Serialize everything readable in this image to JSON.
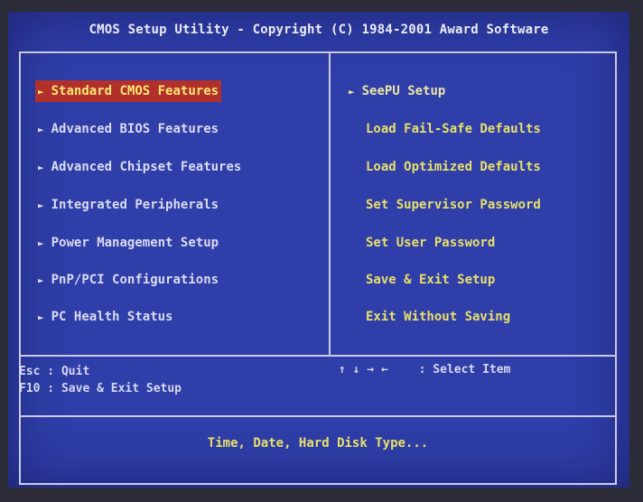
{
  "header": {
    "title": "CMOS Setup Utility - Copyright (C) 1984-2001 Award Software"
  },
  "left_menu": [
    {
      "label": "Standard CMOS Features",
      "selected": true
    },
    {
      "label": "Advanced BIOS Features",
      "selected": false
    },
    {
      "label": "Advanced Chipset Features",
      "selected": false
    },
    {
      "label": "Integrated Peripherals",
      "selected": false
    },
    {
      "label": "Power Management Setup",
      "selected": false
    },
    {
      "label": "PnP/PCI Configurations",
      "selected": false
    },
    {
      "label": "PC Health Status",
      "selected": false
    }
  ],
  "right_menu": [
    {
      "label": "SeePU Setup",
      "arrow": true
    },
    {
      "label": "Load Fail-Safe Defaults",
      "arrow": false
    },
    {
      "label": "Load Optimized Defaults",
      "arrow": false
    },
    {
      "label": "Set Supervisor Password",
      "arrow": false
    },
    {
      "label": "Set User Password",
      "arrow": false
    },
    {
      "label": "Save & Exit Setup",
      "arrow": false
    },
    {
      "label": "Exit Without Saving",
      "arrow": false
    }
  ],
  "arrow_glyph": "►",
  "help": {
    "esc": "Esc : Quit",
    "f10": "F10 : Save & Exit Setup",
    "nav_keys": "↑ ↓ → ←",
    "select": ": Select Item"
  },
  "description": "Time, Date, Hard Disk Type...",
  "colors": {
    "background": "#2f3ea8",
    "border": "#c9cbe6",
    "highlight": "#b1302c",
    "yellow_text": "#e7e06c",
    "white_text": "#d9dbef"
  }
}
